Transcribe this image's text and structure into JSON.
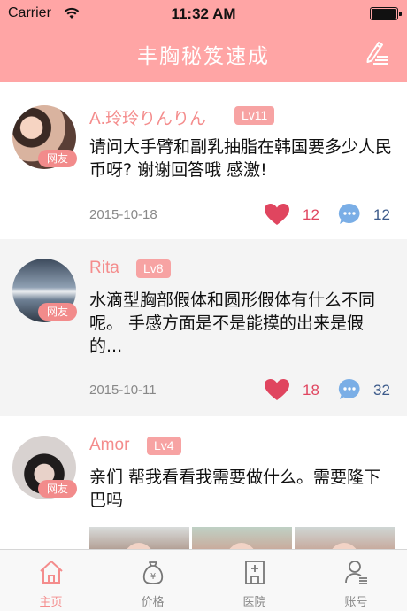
{
  "status_bar": {
    "carrier": "Carrier",
    "time": "11:32 AM"
  },
  "nav": {
    "title": "丰胸秘笈速成",
    "compose_icon": "edit-pen-icon"
  },
  "posts": [
    {
      "username": "A.玲玲りんりん",
      "level": "Lv11",
      "badge": "网友",
      "content": "请问大手臂和副乳抽脂在韩国要多少人民币呀? 谢谢回答哦 感激!",
      "date": "2015-10-18",
      "likes": "12",
      "comments": "12"
    },
    {
      "username": "Rita",
      "level": "Lv8",
      "badge": "网友",
      "content": "水滴型胸部假体和圆形假体有什么不同呢。 手感方面是不是能摸的出来是假的...",
      "date": "2015-10-11",
      "likes": "18",
      "comments": "32"
    },
    {
      "username": "Amor",
      "level": "Lv4",
      "badge": "网友",
      "content": "亲们 帮我看看我需要做什么。需要隆下巴吗"
    }
  ],
  "tabs": [
    {
      "label": "主页",
      "icon": "home-icon",
      "active": true
    },
    {
      "label": "价格",
      "icon": "money-bag-icon",
      "active": false
    },
    {
      "label": "医院",
      "icon": "hospital-icon",
      "active": false
    },
    {
      "label": "账号",
      "icon": "account-icon",
      "active": false
    }
  ],
  "colors": {
    "accent": "#ffa5a5",
    "heart": "#e0455f",
    "comment": "#7aaee6"
  }
}
